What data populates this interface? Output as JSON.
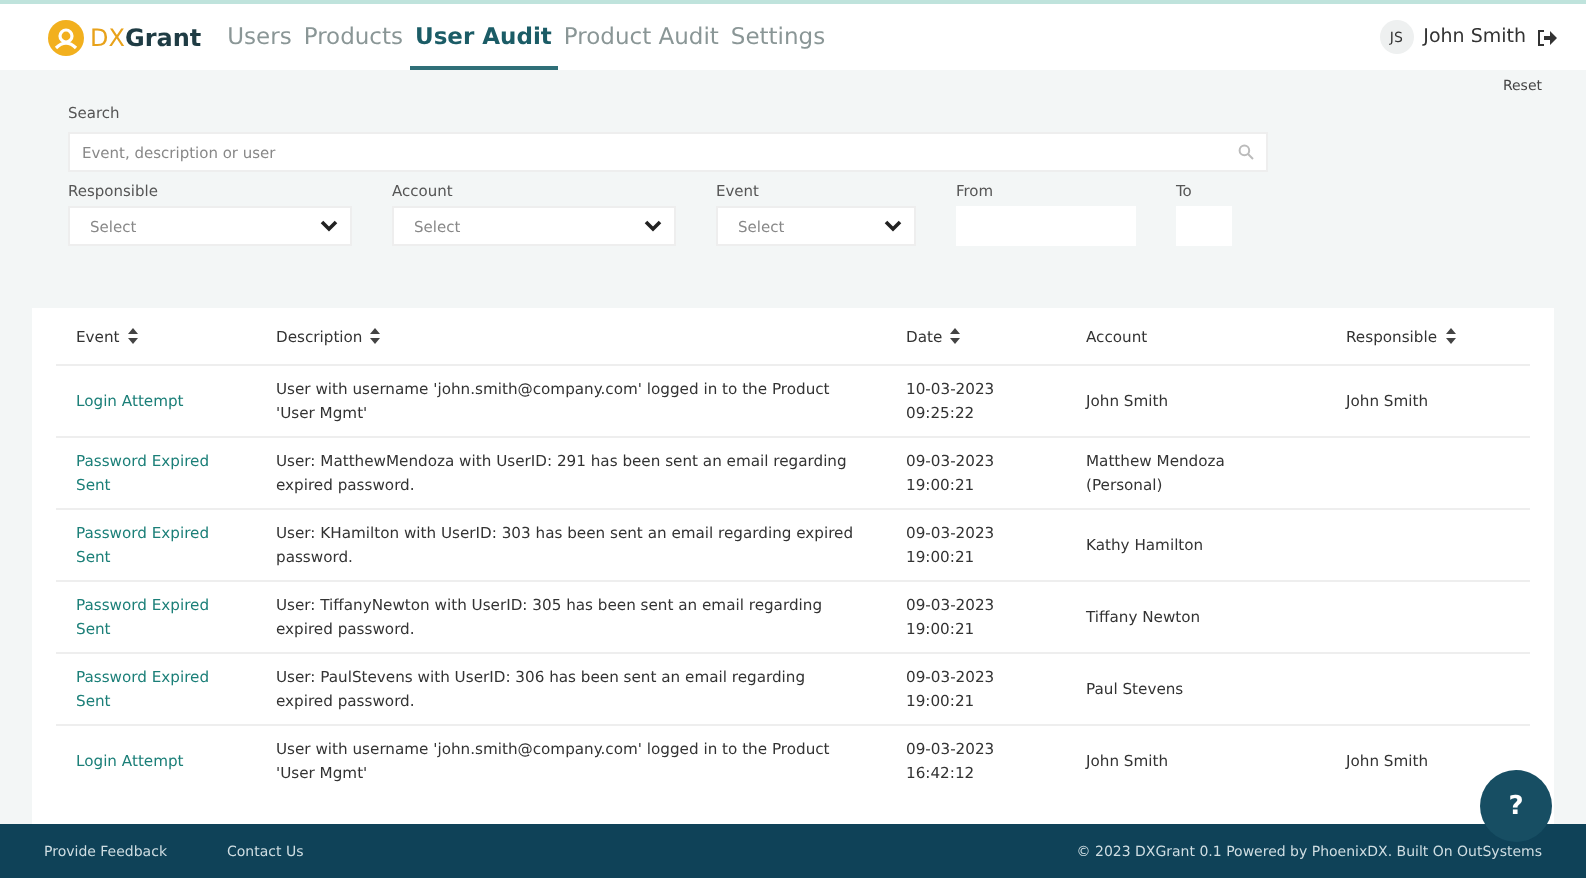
{
  "header": {
    "logo": "DX",
    "logo_bold": "Grant",
    "nav": [
      {
        "label": "Users",
        "selected": false
      },
      {
        "label": "Products",
        "selected": false
      },
      {
        "label": "User Audit",
        "selected": true
      },
      {
        "label": "Product Audit",
        "selected": false
      },
      {
        "label": "Settings",
        "selected": false
      }
    ],
    "user": {
      "initials": "JS",
      "name": "John Smith"
    }
  },
  "filters": {
    "reset": "Reset",
    "search_label": "Search",
    "search_placeholder": "Event, description or user",
    "selects": [
      {
        "label": "Responsible",
        "placeholder": "Select"
      },
      {
        "label": "Account",
        "placeholder": "Select"
      },
      {
        "label": "Event",
        "placeholder": "Select"
      }
    ],
    "dates": [
      {
        "label": "From"
      },
      {
        "label": "To"
      }
    ]
  },
  "table": {
    "columns": [
      {
        "label": "Event",
        "sortable": true
      },
      {
        "label": "Description",
        "sortable": true
      },
      {
        "label": "Date",
        "sortable": true
      },
      {
        "label": "Account",
        "sortable": false
      },
      {
        "label": "Responsible",
        "sortable": true
      }
    ],
    "rows": [
      {
        "event": "Login Attempt",
        "description": "User with username 'john.smith@company.com' logged in to the Product 'User Mgmt'",
        "date": "10-03-2023",
        "time": "09:25:22",
        "account": "John Smith",
        "responsible": "John Smith"
      },
      {
        "event": "Password Expired Sent",
        "description": "User: MatthewMendoza with UserID: 291 has been sent an email regarding expired password.",
        "date": "09-03-2023",
        "time": "19:00:21",
        "account": "Matthew Mendoza (Personal)"
      },
      {
        "event": "Password Expired Sent",
        "description": "User: KHamilton with UserID: 303 has been sent an email regarding expired password.",
        "date": "09-03-2023",
        "time": "19:00:21",
        "account": "Kathy Hamilton"
      },
      {
        "event": "Password Expired Sent",
        "description": "User: TiffanyNewton with UserID: 305 has been sent an email regarding expired password.",
        "date": "09-03-2023",
        "time": "19:00:21",
        "account": "Tiffany Newton"
      },
      {
        "event": "Password Expired Sent",
        "description": "User: PaulStevens with UserID: 306 has been sent an email regarding expired password.",
        "date": "09-03-2023",
        "time": "19:00:21",
        "account": "Paul Stevens"
      },
      {
        "event": "Login Attempt",
        "description": "User with username 'john.smith@company.com' logged in to the Product 'User Mgmt'",
        "date": "09-03-2023",
        "time": "16:42:12",
        "account": "John Smith",
        "responsible": "John Smith"
      }
    ]
  },
  "help_button": "?",
  "footer": {
    "links": [
      "Provide Feedback",
      "Contact Us"
    ],
    "copyright": "© 2023 DXGrant 0.1 Powered by PhoenixDX. Built On OutSystems"
  }
}
